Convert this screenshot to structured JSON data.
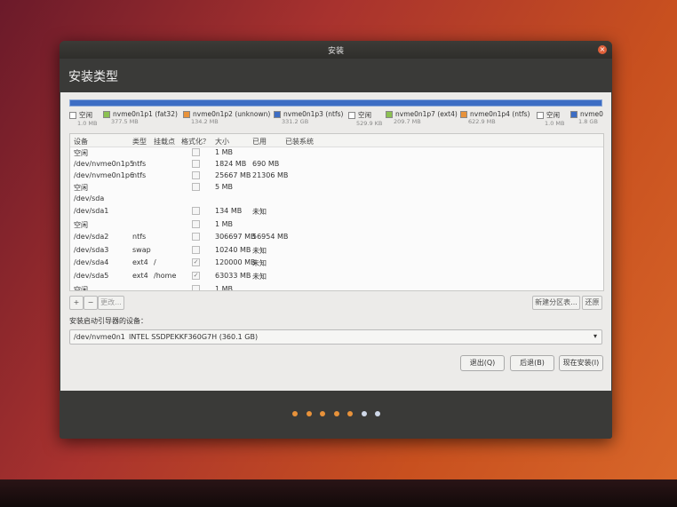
{
  "window": {
    "title": "安装",
    "close_glyph": "×",
    "header": "安装类型"
  },
  "partitions_bar_color": "#3d6dc4",
  "legend": [
    {
      "name": "空闲",
      "size": "1.0 MB",
      "color": "#ffffff"
    },
    {
      "name": "nvme0n1p1 (fat32)",
      "size": "377.5 MB",
      "color": "#8cc152"
    },
    {
      "name": "nvme0n1p2 (unknown)",
      "size": "134.2 MB",
      "color": "#e8923a"
    },
    {
      "name": "nvme0n1p3 (ntfs)",
      "size": "331.2 GB",
      "color": "#3d6dc4"
    },
    {
      "name": "空闲",
      "size": "529.9 KB",
      "color": "#ffffff"
    },
    {
      "name": "nvme0n1p7 (ext4)",
      "size": "209.7 MB",
      "color": "#8cc152"
    },
    {
      "name": "nvme0n1p4 (ntfs)",
      "size": "622.9 MB",
      "color": "#e8923a"
    },
    {
      "name": "空闲",
      "size": "1.0 MB",
      "color": "#ffffff"
    },
    {
      "name": "nvme0",
      "size": "1.8 GB",
      "color": "#3d6dc4"
    }
  ],
  "table": {
    "headers": {
      "device": "设备",
      "type": "类型",
      "mount": "挂载点",
      "format": "格式化？",
      "size": "大小",
      "used": "已用",
      "system": "已装系统"
    },
    "rows": [
      {
        "device": "空闲",
        "type": "",
        "mount": "",
        "format": "",
        "size": "1 MB",
        "used": "",
        "checkbox": true
      },
      {
        "device": "/dev/nvme0n1p5",
        "type": "ntfs",
        "mount": "",
        "format": "",
        "size": "1824 MB",
        "used": "690 MB",
        "checkbox": true
      },
      {
        "device": "/dev/nvme0n1p6",
        "type": "ntfs",
        "mount": "",
        "format": "",
        "size": "25667 MB",
        "used": "21306 MB",
        "checkbox": true
      },
      {
        "device": "空闲",
        "type": "",
        "mount": "",
        "format": "",
        "size": "5 MB",
        "used": "",
        "checkbox": true
      },
      {
        "device": "/dev/sda",
        "type": "",
        "mount": "",
        "format": "",
        "size": "",
        "used": "",
        "checkbox": false
      },
      {
        "device": "/dev/sda1",
        "type": "",
        "mount": "",
        "format": "",
        "size": "134 MB",
        "used": "未知",
        "checkbox": true
      },
      {
        "device": "空闲",
        "type": "",
        "mount": "",
        "format": "",
        "size": "1 MB",
        "used": "",
        "checkbox": true
      },
      {
        "device": "/dev/sda2",
        "type": "ntfs",
        "mount": "",
        "format": "",
        "size": "306697 MB",
        "used": "56954 MB",
        "checkbox": true
      },
      {
        "device": "/dev/sda3",
        "type": "swap",
        "mount": "",
        "format": "",
        "size": "10240 MB",
        "used": "未知",
        "checkbox": true
      },
      {
        "device": "/dev/sda4",
        "type": "ext4",
        "mount": "/",
        "format": "✓",
        "size": "120000 MB",
        "used": "未知",
        "checkbox": true
      },
      {
        "device": "/dev/sda5",
        "type": "ext4",
        "mount": "/home",
        "format": "✓",
        "size": "63033 MB",
        "used": "未知",
        "checkbox": true
      },
      {
        "device": "空闲",
        "type": "",
        "mount": "",
        "format": "",
        "size": "1 MB",
        "used": "",
        "checkbox": true
      }
    ]
  },
  "toolbar": {
    "add": "+",
    "remove": "−",
    "change": "更改...",
    "new_table": "新建分区表...",
    "revert": "还原"
  },
  "boot": {
    "label": "安装启动引导器的设备：",
    "device": "/dev/nvme0n1",
    "model": "INTEL SSDPEKKF360G7H (360.1 GB)"
  },
  "buttons": {
    "quit": "退出(Q)",
    "back": "后退(B)",
    "install": "现在安装(I)"
  },
  "progress_dots": {
    "total": 7,
    "completed": 5,
    "active_color": "#e8923a",
    "inactive_color": "#cfd8e8"
  }
}
